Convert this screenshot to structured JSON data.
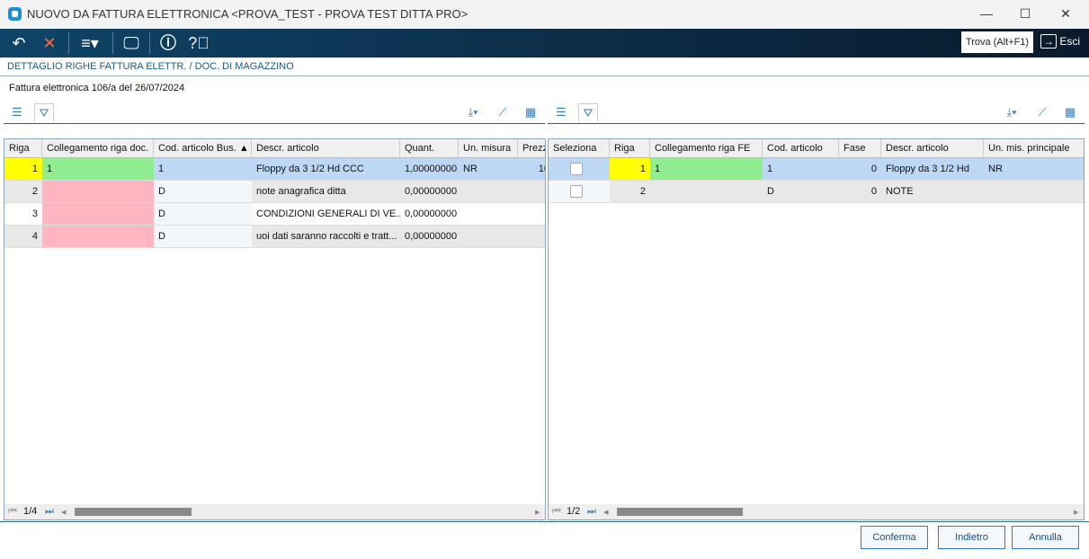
{
  "window": {
    "title": "NUOVO DA FATTURA ELETTRONICA <PROVA_TEST - PROVA TEST DITTA PRO>",
    "minimize": "—",
    "maximize": "☐",
    "close": "✕"
  },
  "toolbar": {
    "find": "Trova (Alt+F1)",
    "exit": "Esci"
  },
  "breadcrumb": "DETTAGLIO RIGHE FATTURA ELETTR. / DOC. DI MAGAZZINO",
  "info": "Fattura elettronica 106/a del 26/07/2024",
  "colors": {
    "selected": "#bcd8f5",
    "riga": "#ffff00",
    "linked": "#90ee90",
    "unlinked": "#ffb6c1"
  },
  "left_grid": {
    "columns": [
      "Riga",
      "Collegamento riga doc.",
      "Cod. articolo Bus. ▲",
      "Descr. articolo",
      "Quant.",
      "Un. misura",
      "Prezz"
    ],
    "rows": [
      [
        "1",
        "1",
        "1",
        "Floppy da 3 1/2 Hd CCC",
        "1,00000000",
        "NR",
        "10"
      ],
      [
        "2",
        "",
        "D",
        "note anagrafica ditta",
        "0,00000000",
        "",
        ""
      ],
      [
        "3",
        "",
        "D",
        "CONDIZIONI GENERALI DI VE...",
        "0,00000000",
        "",
        ""
      ],
      [
        "4",
        "",
        "D",
        "uoi dati saranno raccolti e tratt...",
        "0,00000000",
        "",
        ""
      ]
    ],
    "pager": "1/4"
  },
  "right_grid": {
    "columns": [
      "Seleziona",
      "Riga",
      "Collegamento riga FE",
      "Cod. articolo",
      "Fase",
      "Descr. articolo",
      "Un. mis. principale"
    ],
    "rows": [
      [
        "",
        "1",
        "1",
        "1",
        "0",
        "Floppy da 3 1/2 Hd",
        "NR"
      ],
      [
        "",
        "2",
        "",
        "D",
        "0",
        "NOTE",
        ""
      ]
    ],
    "pager": "1/2"
  },
  "buttons": {
    "confirm": "Conferma",
    "back": "Indietro",
    "cancel": "Annulla"
  }
}
